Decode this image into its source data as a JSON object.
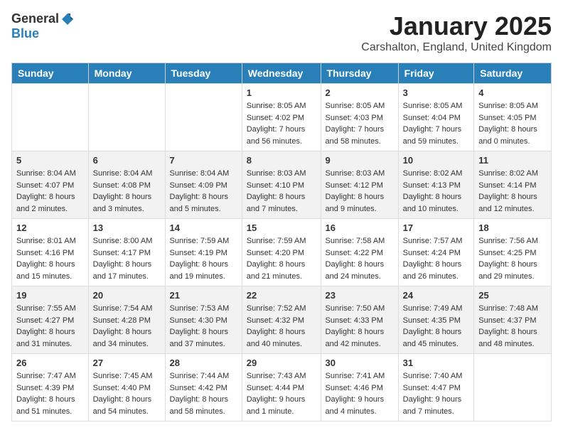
{
  "header": {
    "logo_general": "General",
    "logo_blue": "Blue",
    "title": "January 2025",
    "subtitle": "Carshalton, England, United Kingdom"
  },
  "days_of_week": [
    "Sunday",
    "Monday",
    "Tuesday",
    "Wednesday",
    "Thursday",
    "Friday",
    "Saturday"
  ],
  "weeks": [
    [
      {
        "day": "",
        "info": ""
      },
      {
        "day": "",
        "info": ""
      },
      {
        "day": "",
        "info": ""
      },
      {
        "day": "1",
        "info": "Sunrise: 8:05 AM\nSunset: 4:02 PM\nDaylight: 7 hours and 56 minutes."
      },
      {
        "day": "2",
        "info": "Sunrise: 8:05 AM\nSunset: 4:03 PM\nDaylight: 7 hours and 58 minutes."
      },
      {
        "day": "3",
        "info": "Sunrise: 8:05 AM\nSunset: 4:04 PM\nDaylight: 7 hours and 59 minutes."
      },
      {
        "day": "4",
        "info": "Sunrise: 8:05 AM\nSunset: 4:05 PM\nDaylight: 8 hours and 0 minutes."
      }
    ],
    [
      {
        "day": "5",
        "info": "Sunrise: 8:04 AM\nSunset: 4:07 PM\nDaylight: 8 hours and 2 minutes."
      },
      {
        "day": "6",
        "info": "Sunrise: 8:04 AM\nSunset: 4:08 PM\nDaylight: 8 hours and 3 minutes."
      },
      {
        "day": "7",
        "info": "Sunrise: 8:04 AM\nSunset: 4:09 PM\nDaylight: 8 hours and 5 minutes."
      },
      {
        "day": "8",
        "info": "Sunrise: 8:03 AM\nSunset: 4:10 PM\nDaylight: 8 hours and 7 minutes."
      },
      {
        "day": "9",
        "info": "Sunrise: 8:03 AM\nSunset: 4:12 PM\nDaylight: 8 hours and 9 minutes."
      },
      {
        "day": "10",
        "info": "Sunrise: 8:02 AM\nSunset: 4:13 PM\nDaylight: 8 hours and 10 minutes."
      },
      {
        "day": "11",
        "info": "Sunrise: 8:02 AM\nSunset: 4:14 PM\nDaylight: 8 hours and 12 minutes."
      }
    ],
    [
      {
        "day": "12",
        "info": "Sunrise: 8:01 AM\nSunset: 4:16 PM\nDaylight: 8 hours and 15 minutes."
      },
      {
        "day": "13",
        "info": "Sunrise: 8:00 AM\nSunset: 4:17 PM\nDaylight: 8 hours and 17 minutes."
      },
      {
        "day": "14",
        "info": "Sunrise: 7:59 AM\nSunset: 4:19 PM\nDaylight: 8 hours and 19 minutes."
      },
      {
        "day": "15",
        "info": "Sunrise: 7:59 AM\nSunset: 4:20 PM\nDaylight: 8 hours and 21 minutes."
      },
      {
        "day": "16",
        "info": "Sunrise: 7:58 AM\nSunset: 4:22 PM\nDaylight: 8 hours and 24 minutes."
      },
      {
        "day": "17",
        "info": "Sunrise: 7:57 AM\nSunset: 4:24 PM\nDaylight: 8 hours and 26 minutes."
      },
      {
        "day": "18",
        "info": "Sunrise: 7:56 AM\nSunset: 4:25 PM\nDaylight: 8 hours and 29 minutes."
      }
    ],
    [
      {
        "day": "19",
        "info": "Sunrise: 7:55 AM\nSunset: 4:27 PM\nDaylight: 8 hours and 31 minutes."
      },
      {
        "day": "20",
        "info": "Sunrise: 7:54 AM\nSunset: 4:28 PM\nDaylight: 8 hours and 34 minutes."
      },
      {
        "day": "21",
        "info": "Sunrise: 7:53 AM\nSunset: 4:30 PM\nDaylight: 8 hours and 37 minutes."
      },
      {
        "day": "22",
        "info": "Sunrise: 7:52 AM\nSunset: 4:32 PM\nDaylight: 8 hours and 40 minutes."
      },
      {
        "day": "23",
        "info": "Sunrise: 7:50 AM\nSunset: 4:33 PM\nDaylight: 8 hours and 42 minutes."
      },
      {
        "day": "24",
        "info": "Sunrise: 7:49 AM\nSunset: 4:35 PM\nDaylight: 8 hours and 45 minutes."
      },
      {
        "day": "25",
        "info": "Sunrise: 7:48 AM\nSunset: 4:37 PM\nDaylight: 8 hours and 48 minutes."
      }
    ],
    [
      {
        "day": "26",
        "info": "Sunrise: 7:47 AM\nSunset: 4:39 PM\nDaylight: 8 hours and 51 minutes."
      },
      {
        "day": "27",
        "info": "Sunrise: 7:45 AM\nSunset: 4:40 PM\nDaylight: 8 hours and 54 minutes."
      },
      {
        "day": "28",
        "info": "Sunrise: 7:44 AM\nSunset: 4:42 PM\nDaylight: 8 hours and 58 minutes."
      },
      {
        "day": "29",
        "info": "Sunrise: 7:43 AM\nSunset: 4:44 PM\nDaylight: 9 hours and 1 minute."
      },
      {
        "day": "30",
        "info": "Sunrise: 7:41 AM\nSunset: 4:46 PM\nDaylight: 9 hours and 4 minutes."
      },
      {
        "day": "31",
        "info": "Sunrise: 7:40 AM\nSunset: 4:47 PM\nDaylight: 9 hours and 7 minutes."
      },
      {
        "day": "",
        "info": ""
      }
    ]
  ]
}
